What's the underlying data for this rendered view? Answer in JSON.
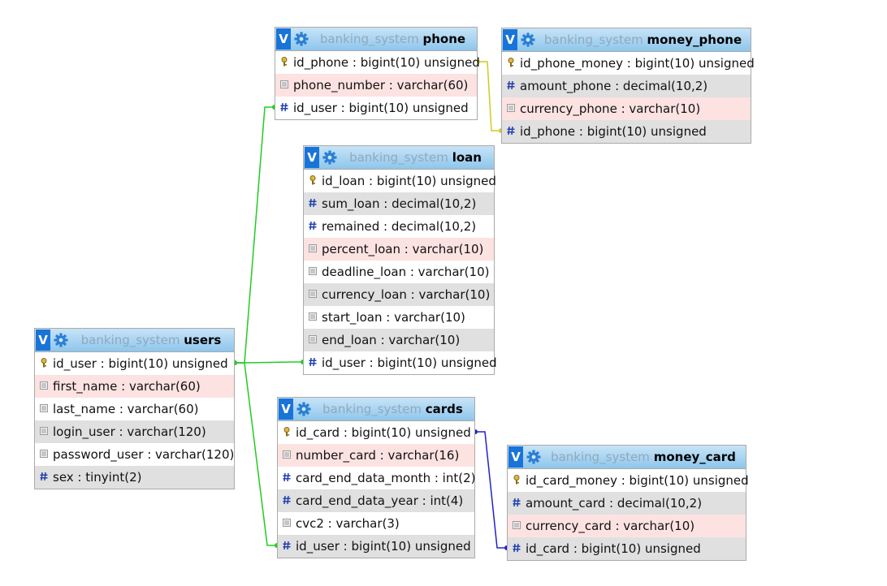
{
  "tables": [
    {
      "id": "phone",
      "db": "banking_system",
      "name": "phone",
      "columns": [
        {
          "text": "id_phone : bigint(10) unsigned",
          "icon": "key-icon",
          "bg": "w"
        },
        {
          "text": "phone_number : varchar(60)",
          "icon": "text-field-icon",
          "bg": "p"
        },
        {
          "text": "id_user : bigint(10) unsigned",
          "icon": "hash-icon",
          "bg": "w"
        }
      ]
    },
    {
      "id": "money_phone",
      "db": "banking_system",
      "name": "money_phone",
      "columns": [
        {
          "text": "id_phone_money : bigint(10) unsigned",
          "icon": "key-icon",
          "bg": "w"
        },
        {
          "text": "amount_phone : decimal(10,2)",
          "icon": "hash-icon",
          "bg": "g"
        },
        {
          "text": "currency_phone : varchar(10)",
          "icon": "text-field-icon",
          "bg": "p"
        },
        {
          "text": "id_phone : bigint(10) unsigned",
          "icon": "hash-icon",
          "bg": "g"
        }
      ]
    },
    {
      "id": "loan",
      "db": "banking_system",
      "name": "loan",
      "columns": [
        {
          "text": "id_loan : bigint(10) unsigned",
          "icon": "key-icon",
          "bg": "w"
        },
        {
          "text": "sum_loan : decimal(10,2)",
          "icon": "hash-icon",
          "bg": "g"
        },
        {
          "text": "remained : decimal(10,2)",
          "icon": "hash-icon",
          "bg": "w"
        },
        {
          "text": "percent_loan : varchar(10)",
          "icon": "text-field-icon",
          "bg": "p"
        },
        {
          "text": "deadline_loan : varchar(10)",
          "icon": "text-field-icon",
          "bg": "w"
        },
        {
          "text": "currency_loan : varchar(10)",
          "icon": "text-field-icon",
          "bg": "g"
        },
        {
          "text": "start_loan : varchar(10)",
          "icon": "text-field-icon",
          "bg": "w"
        },
        {
          "text": "end_loan : varchar(10)",
          "icon": "text-field-icon",
          "bg": "g"
        },
        {
          "text": "id_user : bigint(10) unsigned",
          "icon": "hash-icon",
          "bg": "w"
        }
      ]
    },
    {
      "id": "users",
      "db": "banking_system",
      "name": "users",
      "columns": [
        {
          "text": "id_user : bigint(10) unsigned",
          "icon": "key-icon",
          "bg": "w"
        },
        {
          "text": "first_name : varchar(60)",
          "icon": "text-field-icon",
          "bg": "p"
        },
        {
          "text": "last_name : varchar(60)",
          "icon": "text-field-icon",
          "bg": "w"
        },
        {
          "text": "login_user : varchar(120)",
          "icon": "text-field-icon",
          "bg": "g"
        },
        {
          "text": "password_user : varchar(120)",
          "icon": "text-field-icon",
          "bg": "w"
        },
        {
          "text": "sex : tinyint(2)",
          "icon": "hash-icon",
          "bg": "g"
        }
      ]
    },
    {
      "id": "cards",
      "db": "banking_system",
      "name": "cards",
      "columns": [
        {
          "text": "id_card : bigint(10) unsigned",
          "icon": "key-icon",
          "bg": "w"
        },
        {
          "text": "number_card : varchar(16)",
          "icon": "text-field-icon",
          "bg": "p"
        },
        {
          "text": "card_end_data_month : int(2)",
          "icon": "hash-icon",
          "bg": "w"
        },
        {
          "text": "card_end_data_year : int(4)",
          "icon": "hash-icon",
          "bg": "g"
        },
        {
          "text": "cvc2 : varchar(3)",
          "icon": "text-field-icon",
          "bg": "w"
        },
        {
          "text": "id_user : bigint(10) unsigned",
          "icon": "hash-icon",
          "bg": "g"
        }
      ]
    },
    {
      "id": "money_card",
      "db": "banking_system",
      "name": "money_card",
      "columns": [
        {
          "text": "id_card_money : bigint(10) unsigned",
          "icon": "key-icon",
          "bg": "w"
        },
        {
          "text": "amount_card : decimal(10,2)",
          "icon": "hash-icon",
          "bg": "g"
        },
        {
          "text": "currency_card : varchar(10)",
          "icon": "text-field-icon",
          "bg": "p"
        },
        {
          "text": "id_card : bigint(10) unsigned",
          "icon": "hash-icon",
          "bg": "g"
        }
      ]
    }
  ],
  "toggle_label": "V",
  "relations": [
    {
      "from": "users.id_user",
      "to": "phone.id_user",
      "color": "#22cc22"
    },
    {
      "from": "users.id_user",
      "to": "loan.id_user",
      "color": "#22cc22"
    },
    {
      "from": "users.id_user",
      "to": "cards.id_user",
      "color": "#22cc22"
    },
    {
      "from": "phone.id_phone",
      "to": "money_phone.id_phone",
      "color": "#cccc22"
    },
    {
      "from": "cards.id_card",
      "to": "money_card.id_card",
      "color": "#2222cc"
    }
  ]
}
